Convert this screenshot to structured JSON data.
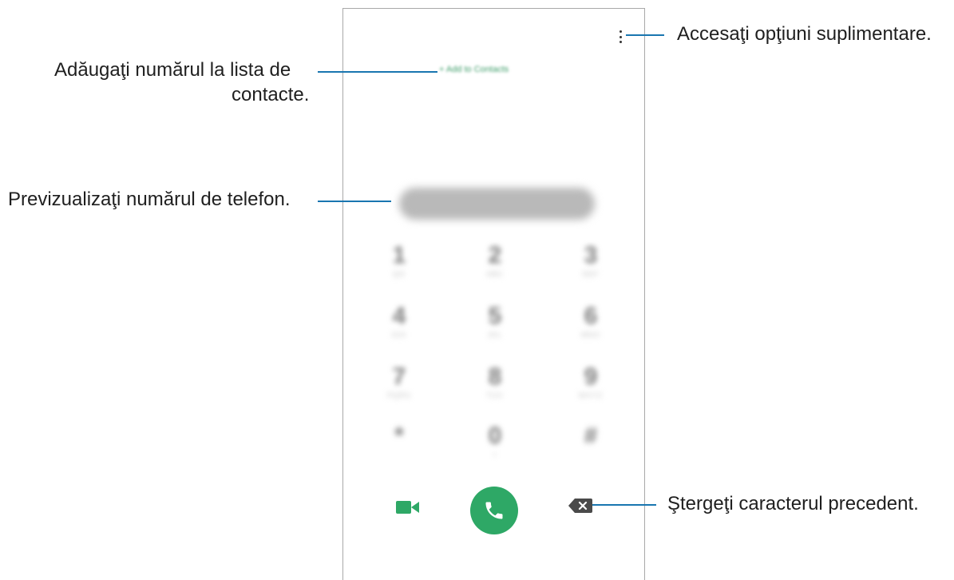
{
  "phone": {
    "add_to_contacts": "+ Add to Contacts",
    "keypad": [
      {
        "digit": "1",
        "letters": "QO"
      },
      {
        "digit": "2",
        "letters": "ABC"
      },
      {
        "digit": "3",
        "letters": "DEF"
      },
      {
        "digit": "4",
        "letters": "GHI"
      },
      {
        "digit": "5",
        "letters": "JKL"
      },
      {
        "digit": "6",
        "letters": "MNO"
      },
      {
        "digit": "7",
        "letters": "PQRS"
      },
      {
        "digit": "8",
        "letters": "TUV"
      },
      {
        "digit": "9",
        "letters": "WXYZ"
      },
      {
        "digit": "*",
        "letters": ""
      },
      {
        "digit": "0",
        "letters": "+"
      },
      {
        "digit": "#",
        "letters": ""
      }
    ],
    "icons": {
      "more": "more-options-icon",
      "video": "video-call-icon",
      "call": "phone-call-icon",
      "backspace": "backspace-icon"
    },
    "colors": {
      "accent": "#2ea866",
      "callout_line": "#1976b0"
    }
  },
  "callouts": {
    "more_options": "Accesaţi opţiuni suplimentare.",
    "add_contacts_line1": "Adăugaţi numărul la lista de",
    "add_contacts_line2": "contacte.",
    "preview_number": "Previzualizaţi numărul de telefon.",
    "delete_char": "Ştergeţi caracterul precedent."
  }
}
